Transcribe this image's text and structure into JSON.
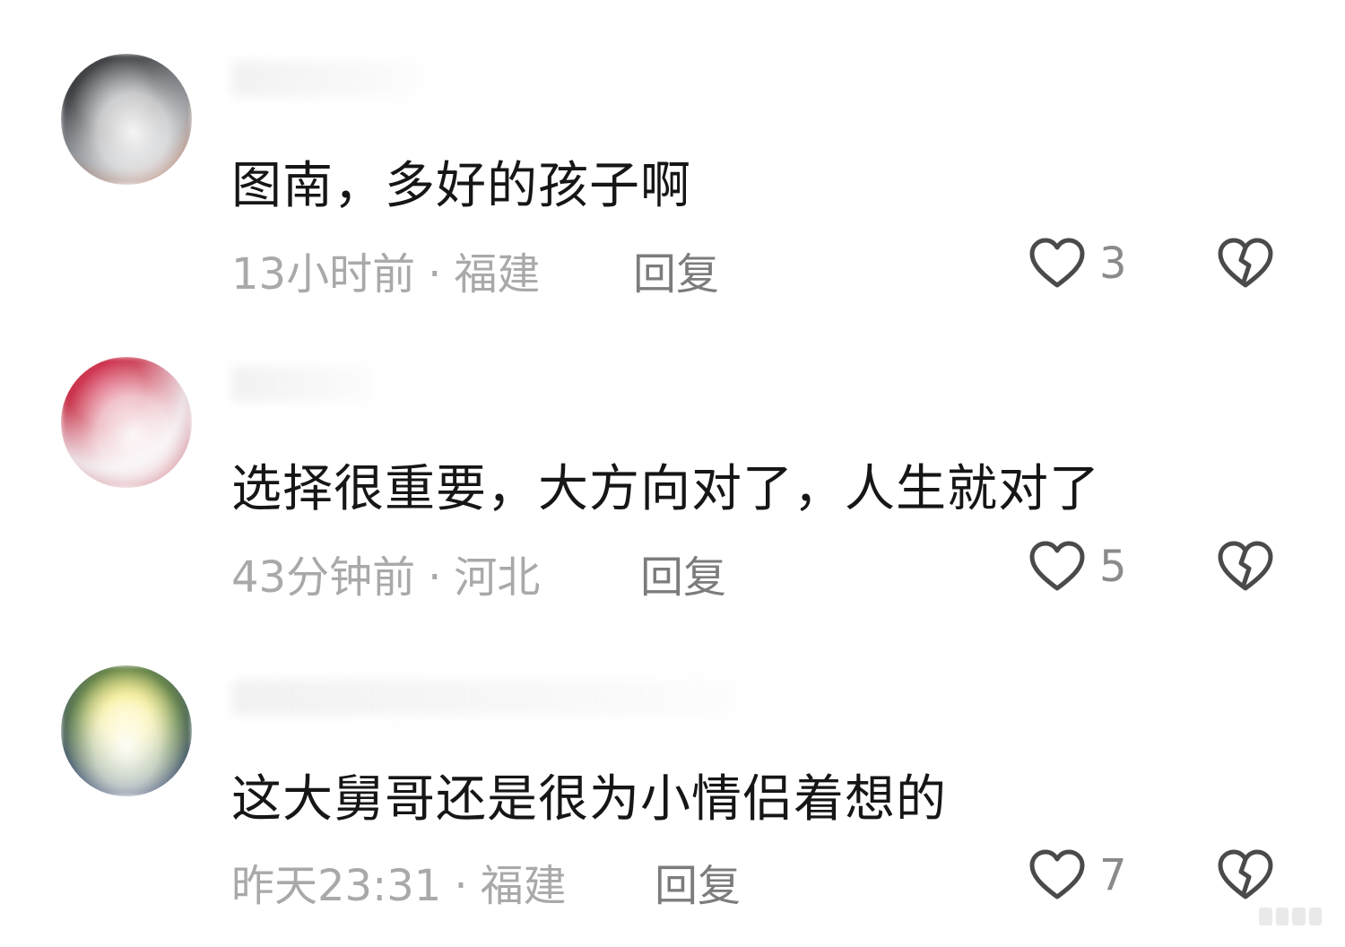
{
  "comments": [
    {
      "text": "图南，多好的孩子啊",
      "time": "13小时前",
      "location": "福建",
      "reply": "回复",
      "likes": "3",
      "avatar_colors": [
        "#3d3f42",
        "#8a8f96",
        "#d3683d"
      ]
    },
    {
      "text": "选择很重要，大方向对了，人生就对了",
      "time": "43分钟前",
      "location": "河北",
      "reply": "回复",
      "likes": "5",
      "avatar_colors": [
        "#c8334a",
        "#e8e2e6",
        "#b82a3a"
      ]
    },
    {
      "text": "这大舅哥还是很为小情侣着想的",
      "time": "昨天23:31",
      "location": "福建",
      "reply": "回复",
      "likes": "7",
      "avatar_colors": [
        "#3a4e6c",
        "#f1e45a",
        "#6c8a4c"
      ]
    }
  ],
  "separator": "·",
  "icons": {
    "like": "heart-outline-icon",
    "dislike": "broken-heart-icon"
  },
  "colors": {
    "text": "#161616",
    "meta": "#a9a9a9",
    "icon": "#4a4a4a"
  }
}
